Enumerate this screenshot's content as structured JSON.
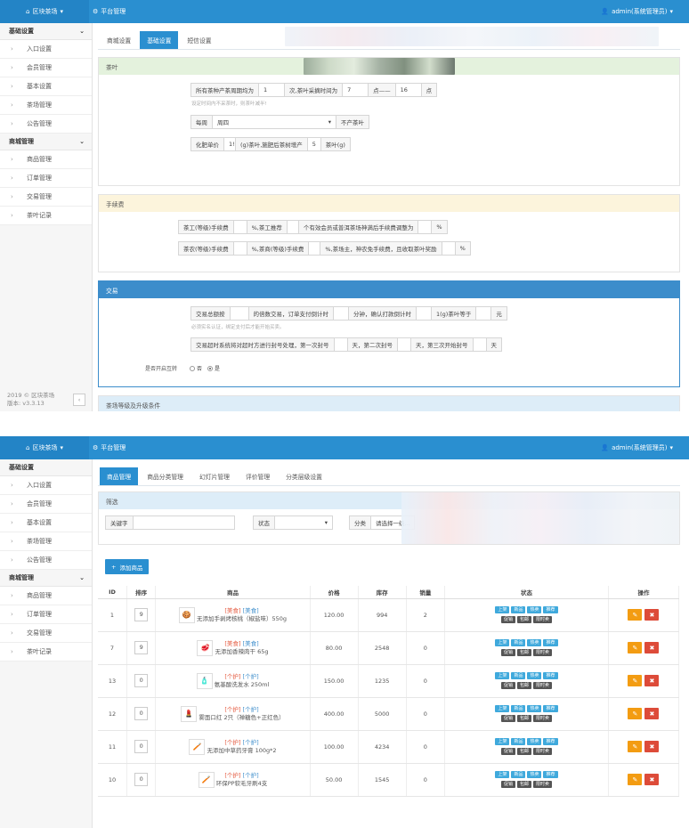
{
  "header": {
    "brand": "区块茶场",
    "platform": "平台管理",
    "admin": "admin(系统管理员)"
  },
  "sidebar": {
    "groups": [
      {
        "label": "基础设置",
        "items": [
          "入口设置",
          "会员管理",
          "基本设置",
          "茶场管理",
          "公告管理"
        ]
      },
      {
        "label": "商城管理",
        "items": [
          "商品管理",
          "订单管理",
          "交易管理",
          "茶叶记录"
        ]
      }
    ],
    "footer_line1": "2019 © 区块茶场",
    "footer_line2": "版本: v3.3.13"
  },
  "screen1": {
    "tabs": [
      "商城设置",
      "基础设置",
      "短信设置"
    ],
    "active_tab": 1,
    "tea": {
      "title": "茶叶",
      "row1": {
        "c1": "所有茶种产茶周期均为",
        "v1": "1",
        "c2": "次,茶叶采摘时间为",
        "v2": "7",
        "c3": "点——",
        "v3": "16",
        "c4": "点"
      },
      "hint": "设定时间内不采茶时，则茶叶减半!",
      "row2": {
        "c1": "每周",
        "select": "周四",
        "c2": "不产茶叶"
      },
      "row3": {
        "c1": "化肥单价",
        "v1": "1!",
        "c2": "(g)茶叶,施肥后茶树增产",
        "v2": "5",
        "c3": "茶叶(g)"
      }
    },
    "fee": {
      "title": "手续费",
      "row1": {
        "c1": "茶工(等级)手续费",
        "c2": "%,茶工推荐",
        "c3": "个有效会员或普洱茶场神满后手续费调整为",
        "c4": "%"
      },
      "row2": {
        "c1": "茶农(等级)手续费",
        "c2": "%,茶商(等级)手续费",
        "c3": "%,茶场主，神农免手续费，且收取茶叶奖励",
        "c4": "%"
      }
    },
    "trade": {
      "title": "交易",
      "row1": {
        "c1": "交易总额按",
        "c2": "的倍数交易，订单支付倒计时",
        "c3": "分钟，确认打款倒计时",
        "c4": "1(g)茶叶等于",
        "c5": "元"
      },
      "hint": "必须实名认证，绑定支付后才能开始买卖。",
      "row2": {
        "c1": "交易超时系统将对超时方进行封号处理，第一次封号",
        "c2": "天，第二次封号",
        "c3": "天，第三次开始封号",
        "c4": "天"
      },
      "enable_label": "是否开启互转",
      "opt_no": "否",
      "opt_yes": "是"
    },
    "levels": {
      "title": "茶场等级及升级条件"
    }
  },
  "screen2": {
    "tabs": [
      "商品管理",
      "商品分类管理",
      "幻灯片管理",
      "评价管理",
      "分类层级设置"
    ],
    "active_tab": 0,
    "filter": {
      "title": "筛选",
      "keyword_label": "关键字",
      "status_label": "状态",
      "category_label": "分类",
      "category_placeholder": "请选择一级..."
    },
    "add_label": "添加商品",
    "columns": [
      "ID",
      "排序",
      "商品",
      "价格",
      "库存",
      "销量",
      "状态",
      "操作"
    ],
    "badge_row1": [
      "上架",
      "新品",
      "热卖",
      "推荐"
    ],
    "badge_row2": [
      "促销",
      "包邮",
      "限时卖"
    ],
    "rows": [
      {
        "id": "1",
        "sort": "9",
        "icon": "🍪",
        "tag": "[美食]",
        "tag2": "[美食]",
        "name": "无添加手剥烤核桃（椒盐味）550g",
        "price": "120.00",
        "stock": "994",
        "sales": "2"
      },
      {
        "id": "7",
        "sort": "9",
        "icon": "🥩",
        "tag": "[美食]",
        "tag2": "[美食]",
        "name": "无添加香辣肉干 65g",
        "price": "80.00",
        "stock": "2548",
        "sales": "0"
      },
      {
        "id": "13",
        "sort": "0",
        "icon": "🧴",
        "tag": "[个护]",
        "tag2": "[个护]",
        "name": "氨基酸洗发水 250ml",
        "price": "150.00",
        "stock": "1235",
        "sales": "0"
      },
      {
        "id": "12",
        "sort": "0",
        "icon": "💄",
        "tag": "[个护]",
        "tag2": "[个护]",
        "name": "雾面口红 2只（禅糖色+正红色）",
        "price": "400.00",
        "stock": "5000",
        "sales": "0"
      },
      {
        "id": "11",
        "sort": "0",
        "icon": "🪥",
        "tag": "[个护]",
        "tag2": "[个护]",
        "name": "无添加中草药牙膏 100g*2",
        "price": "100.00",
        "stock": "4234",
        "sales": "0"
      },
      {
        "id": "10",
        "sort": "0",
        "icon": "🪥",
        "tag": "[个护]",
        "tag2": "[个护]",
        "name": "环保PP软毛牙刷4支",
        "price": "50.00",
        "stock": "1545",
        "sales": "0"
      }
    ]
  }
}
